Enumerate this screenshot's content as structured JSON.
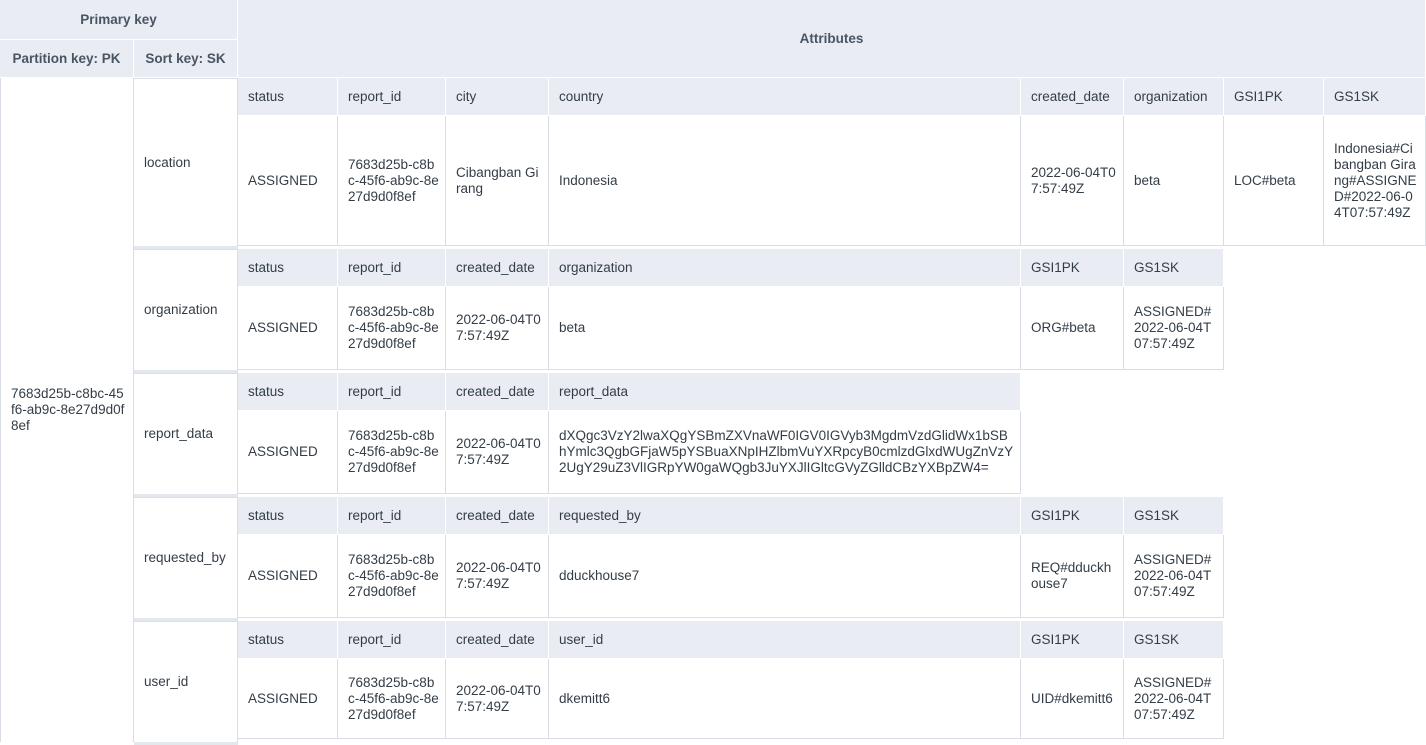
{
  "header": {
    "primary_key": "Primary key",
    "partition_key": "Partition key: PK",
    "sort_key": "Sort key: SK",
    "attributes": "Attributes"
  },
  "partition_key_value": "7683d25b-c8bc-45f6-ab9c-8e27d9d0f8ef",
  "rows": [
    {
      "sort_key": "location",
      "attributes": [
        {
          "name": "status",
          "value": "ASSIGNED"
        },
        {
          "name": "report_id",
          "value": "7683d25b-c8bc-45f6-ab9c-8e27d9d0f8ef"
        },
        {
          "name": "city",
          "value": "Cibangban Girang"
        },
        {
          "name": "country",
          "value": "Indonesia"
        },
        {
          "name": "created_date",
          "value": "2022-06-04T07:57:49Z"
        },
        {
          "name": "organization",
          "value": "beta"
        },
        {
          "name": "GSI1PK",
          "value": "LOC#beta"
        },
        {
          "name": "GS1SK",
          "value": "Indonesia#Cibangban Girang#ASSIGNED#2022-06-04T07:57:49Z"
        }
      ]
    },
    {
      "sort_key": "organization",
      "attributes": [
        {
          "name": "status",
          "value": "ASSIGNED"
        },
        {
          "name": "report_id",
          "value": "7683d25b-c8bc-45f6-ab9c-8e27d9d0f8ef"
        },
        {
          "name": "created_date",
          "value": "2022-06-04T07:57:49Z"
        },
        {
          "name": "organization",
          "value": "beta"
        },
        {
          "name": "GSI1PK",
          "value": "ORG#beta"
        },
        {
          "name": "GS1SK",
          "value": "ASSIGNED#2022-06-04T07:57:49Z"
        }
      ]
    },
    {
      "sort_key": "report_data",
      "attributes": [
        {
          "name": "status",
          "value": "ASSIGNED"
        },
        {
          "name": "report_id",
          "value": "7683d25b-c8bc-45f6-ab9c-8e27d9d0f8ef"
        },
        {
          "name": "created_date",
          "value": "2022-06-04T07:57:49Z"
        },
        {
          "name": "report_data",
          "value": "dXQgc3VzY2lwaXQgYSBmZXVnaWF0IGV0IGVyb3MgdmVzdGlidWx1bSBhYmlc3QgbGFjaW5pYSBuaXNpIHZlbmVuYXRpcyB0cmlzdGlxdWUgZnVzY2UgY29uZ3VlIGRpYW0gaWQgb3JuYXJlIGltcGVyZGlldCBzYXBpZW4="
        }
      ]
    },
    {
      "sort_key": "requested_by",
      "attributes": [
        {
          "name": "status",
          "value": "ASSIGNED"
        },
        {
          "name": "report_id",
          "value": "7683d25b-c8bc-45f6-ab9c-8e27d9d0f8ef"
        },
        {
          "name": "created_date",
          "value": "2022-06-04T07:57:49Z"
        },
        {
          "name": "requested_by",
          "value": "dduckhouse7"
        },
        {
          "name": "GSI1PK",
          "value": "REQ#dduckhouse7"
        },
        {
          "name": "GS1SK",
          "value": "ASSIGNED#2022-06-04T07:57:49Z"
        }
      ]
    },
    {
      "sort_key": "user_id",
      "attributes": [
        {
          "name": "status",
          "value": "ASSIGNED"
        },
        {
          "name": "report_id",
          "value": "7683d25b-c8bc-45f6-ab9c-8e27d9d0f8ef"
        },
        {
          "name": "created_date",
          "value": "2022-06-04T07:57:49Z"
        },
        {
          "name": "user_id",
          "value": "dkemitt6"
        },
        {
          "name": "GSI1PK",
          "value": "UID#dkemitt6"
        },
        {
          "name": "GS1SK",
          "value": "ASSIGNED#2022-06-04T07:57:49Z"
        }
      ]
    }
  ]
}
